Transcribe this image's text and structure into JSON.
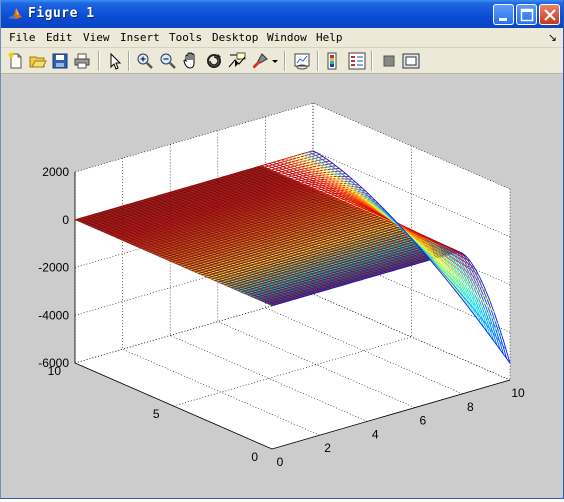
{
  "window": {
    "title": "Figure 1",
    "icon": "matlab-logo-icon",
    "controls": [
      "minimize-icon",
      "maximize-icon",
      "close-icon"
    ]
  },
  "menu": {
    "items": [
      "File",
      "Edit",
      "View",
      "Insert",
      "Tools",
      "Desktop",
      "Window",
      "Help"
    ],
    "dock_arrow": "↘"
  },
  "toolbar": {
    "buttons": [
      "new-figure-icon",
      "open-file-icon",
      "save-icon",
      "print-icon",
      "edit-plot-arrow-icon",
      "zoom-in-icon",
      "zoom-out-icon",
      "pan-hand-icon",
      "rotate-3d-icon",
      "data-cursor-icon",
      "brush-icon",
      "brush-dropdown-icon",
      "link-plot-icon",
      "insert-colorbar-icon",
      "insert-legend-icon",
      "hide-plot-tools-icon",
      "show-plot-tools-icon"
    ]
  },
  "colors": {
    "surface_top": "#7a0000",
    "figure_bg": "#cccccc",
    "axes_bg": "#ffffff"
  },
  "chart_data": {
    "type": "surface",
    "title": "",
    "xlabel": "",
    "ylabel": "",
    "zlabel": "",
    "xlim": [
      0,
      10
    ],
    "ylim": [
      0,
      10
    ],
    "zlim": [
      -6000,
      2000
    ],
    "x_ticks": [
      "0",
      "2",
      "4",
      "6",
      "8",
      "10"
    ],
    "y_ticks": [
      "0",
      "5",
      "10"
    ],
    "z_ticks": [
      "2000",
      "0",
      "-2000",
      "-4000",
      "-6000"
    ],
    "grid": true,
    "colormap": "jet",
    "shading": "mesh",
    "description_values": {
      "z_plateau": 0,
      "z_min_at_x10_y0": -5300
    }
  }
}
